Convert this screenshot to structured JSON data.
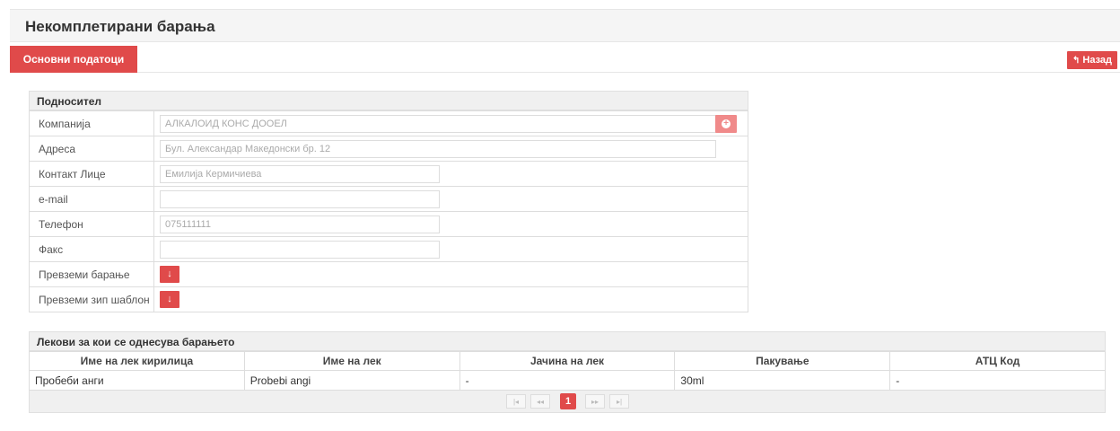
{
  "page": {
    "title": "Некомплетирани барања"
  },
  "tabs": {
    "basic_data": "Основни податоци"
  },
  "back_button": {
    "icon": "↰",
    "label": "Назад"
  },
  "applicant": {
    "heading": "Подносител",
    "fields": {
      "company": {
        "label": "Компанија",
        "value": "АЛКАЛОИД КОНС ДООЕЛ"
      },
      "address": {
        "label": "Адреса",
        "value": "Бул. Александар Македонски бр. 12"
      },
      "contact": {
        "label": "Контакт Лице",
        "value": "Емилија Кермичиева"
      },
      "email": {
        "label": "e-mail",
        "value": ""
      },
      "phone": {
        "label": "Телефон",
        "value": "075111111"
      },
      "fax": {
        "label": "Факс",
        "value": ""
      },
      "download_request": {
        "label": "Превземи барање"
      },
      "download_zip": {
        "label": "Превземи зип шаблон"
      }
    },
    "download_icon": "↓",
    "plus_icon": "+"
  },
  "drugs": {
    "heading": "Лекови за кои се однесува барањето",
    "columns": [
      "Име на лек кирилица",
      "Име на лек",
      "Јачина на лек",
      "Пакување",
      "АТЦ Код"
    ],
    "rows": [
      [
        "Пробеби анги",
        "Probebi angi",
        "-",
        "30ml",
        "-"
      ]
    ],
    "pager": {
      "first": "|◂",
      "prev": "◂◂",
      "current": "1",
      "next": "▸▸",
      "last": "▸|"
    }
  },
  "colors": {
    "accent": "#e04a4a",
    "header_bg": "#f5f5f5"
  }
}
